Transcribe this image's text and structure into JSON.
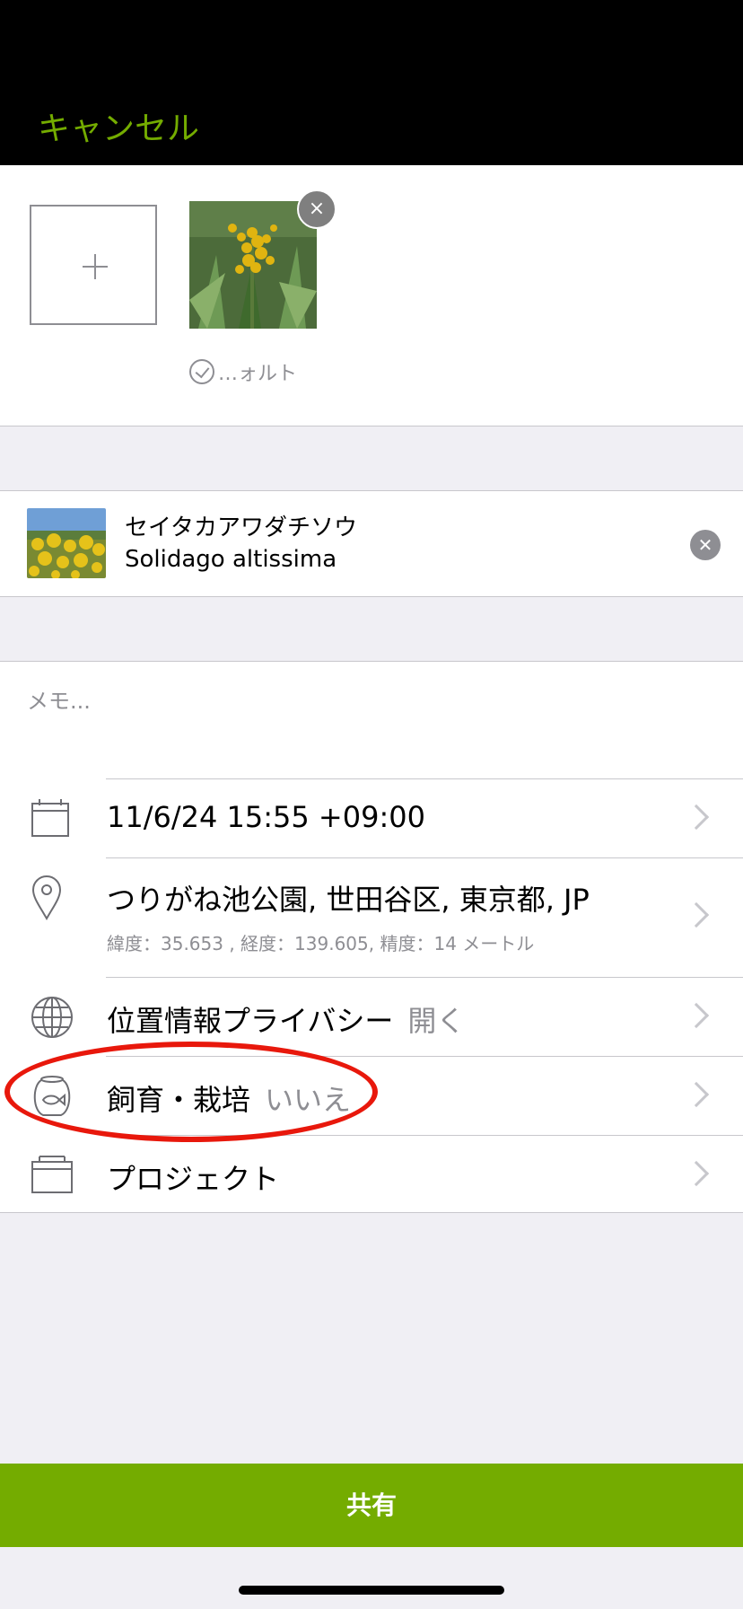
{
  "nav": {
    "cancel_label": "キャンセル"
  },
  "photos": {
    "default_label": "…ォルト",
    "remove_glyph": "×",
    "add_glyph": "+"
  },
  "taxon": {
    "common_name": "セイタカアワダチソウ",
    "scientific_name": "Solidago altissima",
    "remove_glyph": "✕"
  },
  "memo": {
    "placeholder": "メモ..."
  },
  "rows": {
    "datetime": {
      "title": "11/6/24 15:55 +09:00",
      "icon": "calendar-icon"
    },
    "location": {
      "title": "つりがね池公園, 世田谷区, 東京都, JP",
      "sub": "緯度：35.653 , 経度：139.605, 精度：14 メートル",
      "icon": "location-pin-icon"
    },
    "privacy": {
      "title": "位置情報プライバシー",
      "value": "開く",
      "icon": "globe-icon"
    },
    "captive": {
      "title": "飼育・栽培",
      "value": "いいえ",
      "icon": "fishbowl-icon"
    },
    "projects": {
      "title": "プロジェクト",
      "icon": "briefcase-icon"
    }
  },
  "share": {
    "label": "共有"
  },
  "colors": {
    "accent": "#74ac00",
    "highlight": "#e8180c"
  }
}
